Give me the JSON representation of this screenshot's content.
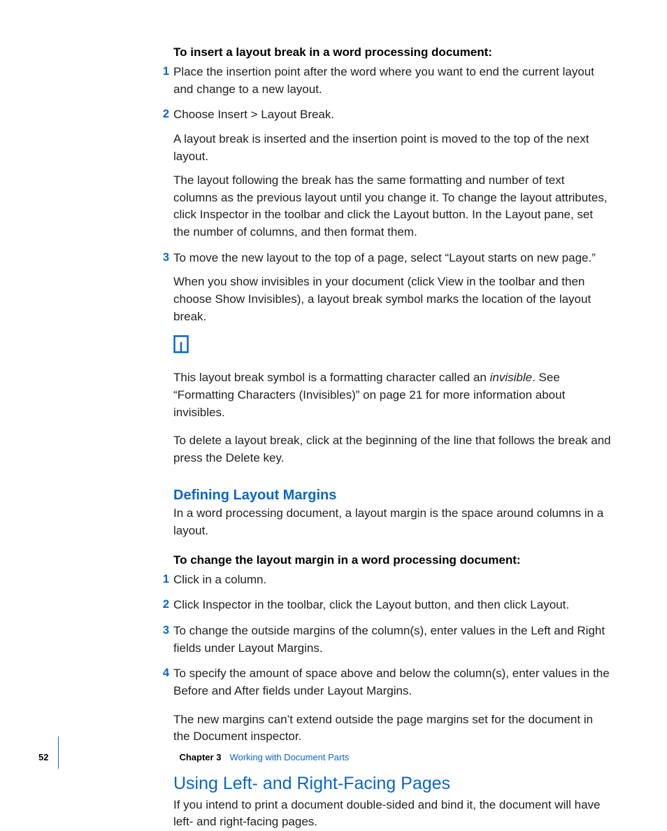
{
  "section1": {
    "lead": "To insert a layout break in a word processing document:",
    "steps": [
      {
        "n": "1",
        "paras": [
          "Place the insertion point after the word where you want to end the current layout and change to a new layout."
        ]
      },
      {
        "n": "2",
        "paras": [
          "Choose Insert > Layout Break.",
          "A layout break is inserted and the insertion point is moved to the top of the next layout.",
          "The layout following the break has the same formatting and number of text columns as the previous layout until you change it. To change the layout attributes, click Inspector in the toolbar and click the Layout button. In the Layout pane, set the number of columns, and then format them."
        ]
      },
      {
        "n": "3",
        "paras": [
          "To move the new layout to the top of a page, select “Layout starts on new page.”",
          "When you show invisibles in your document (click View in the toolbar and then choose Show Invisibles), a layout break symbol marks the location of the layout break."
        ]
      }
    ],
    "after_icon_para_parts": {
      "pre": "This layout break symbol is a formatting character called an ",
      "em": "invisible",
      "post": ". See “Formatting Characters (Invisibles)” on page 21 for more information about invisibles."
    },
    "delete_para": "To delete a layout break, click at the beginning of the line that follows the break and press the Delete key."
  },
  "section2": {
    "heading": "Defining Layout Margins",
    "intro": "In a word processing document, a layout margin is the space around columns in a layout.",
    "lead": "To change the layout margin in a word processing document:",
    "steps": [
      {
        "n": "1",
        "text": "Click in a column."
      },
      {
        "n": "2",
        "text": "Click Inspector in the toolbar, click the Layout button, and then click Layout."
      },
      {
        "n": "3",
        "text": "To change the outside margins of the column(s), enter values in the Left and Right fields under Layout Margins."
      },
      {
        "n": "4",
        "text": "To specify the amount of space above and below the column(s), enter values in the Before and After fields under Layout Margins."
      }
    ],
    "after": "The new margins can’t extend outside the page margins set for the document in the Document inspector."
  },
  "section3": {
    "heading": "Using Left- and Right-Facing Pages",
    "intro": "If you intend to print a document double-sided and bind it, the document will have left- and right-facing pages."
  },
  "footer": {
    "page": "52",
    "chapter_label": "Chapter 3",
    "chapter_title": "Working with Document Parts"
  }
}
